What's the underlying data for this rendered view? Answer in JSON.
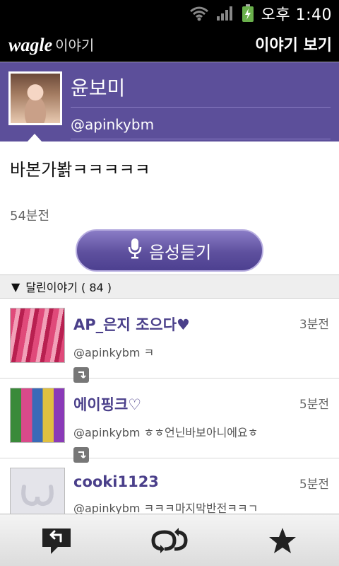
{
  "status_bar": {
    "time": "오후 1:40"
  },
  "header": {
    "logo_text": "wagle",
    "logo_sub": "이야기",
    "title": "이야기 보기"
  },
  "profile": {
    "name": "윤보미",
    "handle": "@apinkybm"
  },
  "post": {
    "text": "바본가봙ㅋㅋㅋㅋㅋ",
    "time": "54분전",
    "voice_label": "음성듣기"
  },
  "comments_header": {
    "label": "달린이야기 ( 84 )"
  },
  "comments": [
    {
      "name": "AP_은지 조으다♥",
      "text": "@apinkybm ㅋ",
      "time": "3분전"
    },
    {
      "name": "에이핑크♡",
      "text": "@apinkybm ㅎㅎ언닌바보아니에요ㅎ",
      "time": "5분전"
    },
    {
      "name": "cooki1123",
      "text": "@apinkybm ㅋㅋㅋ마지막반전ㅋㅋㄱ",
      "time": "5분전"
    }
  ],
  "bottom_bar": {
    "items": [
      "reply-icon",
      "retweet-icon",
      "star-icon"
    ]
  },
  "colors": {
    "accent": "#5c4f9a",
    "name_color": "#4a3f8a"
  }
}
